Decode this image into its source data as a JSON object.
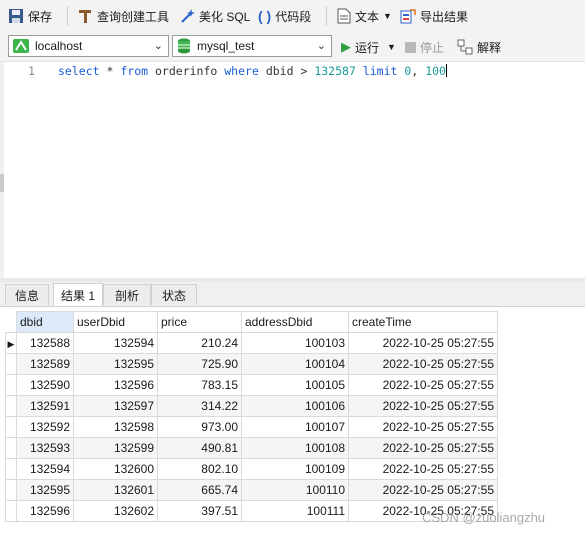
{
  "toolbar": {
    "save": "保存",
    "query_builder": "查询创建工具",
    "beautify": "美化 SQL",
    "snippet": "代码段",
    "text": "文本",
    "export": "导出结果"
  },
  "connection": {
    "host": "localhost",
    "database": "mysql_test",
    "run": "运行",
    "stop": "停止",
    "explain": "解释"
  },
  "editor": {
    "line_number": "1",
    "sql": {
      "select": "select",
      "star": "*",
      "from": "from",
      "table": "orderinfo",
      "where": "where",
      "column": "dbid",
      "op": ">",
      "value": "132587",
      "limit": "limit",
      "offset": "0",
      "comma": ",",
      "count": "100"
    }
  },
  "result_tabs": [
    "信息",
    "结果 1",
    "剖析",
    "状态"
  ],
  "grid": {
    "columns": [
      "dbid",
      "userDbid",
      "price",
      "addressDbid",
      "createTime"
    ],
    "rows": [
      [
        "132588",
        "132594",
        "210.24",
        "100103",
        "2022-10-25 05:27:55"
      ],
      [
        "132589",
        "132595",
        "725.90",
        "100104",
        "2022-10-25 05:27:55"
      ],
      [
        "132590",
        "132596",
        "783.15",
        "100105",
        "2022-10-25 05:27:55"
      ],
      [
        "132591",
        "132597",
        "314.22",
        "100106",
        "2022-10-25 05:27:55"
      ],
      [
        "132592",
        "132598",
        "973.00",
        "100107",
        "2022-10-25 05:27:55"
      ],
      [
        "132593",
        "132599",
        "490.81",
        "100108",
        "2022-10-25 05:27:55"
      ],
      [
        "132594",
        "132600",
        "802.10",
        "100109",
        "2022-10-25 05:27:55"
      ],
      [
        "132595",
        "132601",
        "665.74",
        "100110",
        "2022-10-25 05:27:55"
      ],
      [
        "132596",
        "132602",
        "397.51",
        "100111",
        "2022-10-25 05:27:55"
      ]
    ]
  },
  "watermark": "CSDN @zuoliangzhu"
}
